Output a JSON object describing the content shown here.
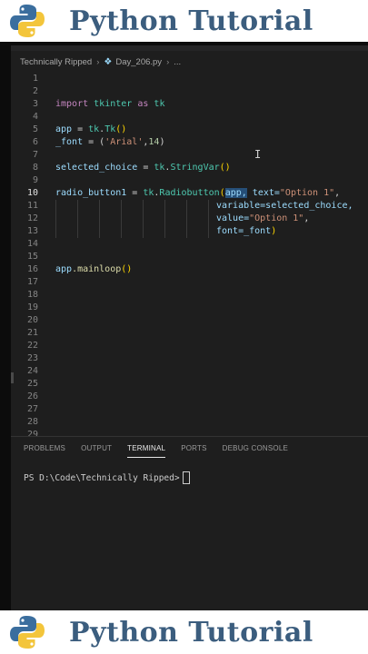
{
  "banner": {
    "title": "Python Tutorial"
  },
  "breadcrumb": {
    "folder": "Technically Ripped",
    "file": "Day_206.py",
    "ellipsis": "..."
  },
  "editor": {
    "active_line": "10",
    "lines": [
      {
        "n": "1"
      },
      {
        "n": "2"
      },
      {
        "n": "3"
      },
      {
        "n": "4"
      },
      {
        "n": "5"
      },
      {
        "n": "6"
      },
      {
        "n": "7"
      },
      {
        "n": "8"
      },
      {
        "n": "9"
      },
      {
        "n": "10"
      },
      {
        "n": "11"
      },
      {
        "n": "12"
      },
      {
        "n": "13"
      },
      {
        "n": "14"
      },
      {
        "n": "15"
      },
      {
        "n": "16"
      },
      {
        "n": "17"
      },
      {
        "n": "18"
      },
      {
        "n": "19"
      },
      {
        "n": "20"
      },
      {
        "n": "21"
      },
      {
        "n": "22"
      },
      {
        "n": "23"
      },
      {
        "n": "24"
      },
      {
        "n": "25"
      },
      {
        "n": "26"
      },
      {
        "n": "27"
      },
      {
        "n": "28"
      },
      {
        "n": "29"
      }
    ],
    "code": {
      "l3_import": "import",
      "l3_mod": "tkinter",
      "l3_as": "as",
      "l3_alias": "tk",
      "l5_var": "app",
      "l5_rest": " = ",
      "l5_mod": "tk",
      "l5_cls": "Tk",
      "l5_paren": "()",
      "l6_var": "_font",
      "l6_eq": " = (",
      "l6_str": "'Arial'",
      "l6_comma": ",",
      "l6_num": "14",
      "l6_close": ")",
      "l8_var": "selected_choice",
      "l8_eq": " = ",
      "l8_mod": "tk",
      "l8_cls": "StringVar",
      "l8_paren": "()",
      "l10_var": "radio_button1",
      "l10_eq": " = ",
      "l10_mod": "tk",
      "l10_cls": "Radiobutton",
      "l10_open": "(",
      "l10_app": "app,",
      "l10_text": " text=",
      "l10_str": "\"Option 1\"",
      "l10_comma": ",",
      "l11": "variable=selected_choice,",
      "l12_key": "value=",
      "l12_str": "\"Option 1\"",
      "l12_comma": ",",
      "l13_key": "font=_font",
      "l13_close": ")",
      "l16_var": "app",
      "l16_fn": ".mainloop",
      "l16_paren": "()"
    }
  },
  "panel": {
    "tabs": [
      "PROBLEMS",
      "OUTPUT",
      "TERMINAL",
      "PORTS",
      "DEBUG CONSOLE"
    ],
    "active_tab": "TERMINAL",
    "prompt": "PS D:\\Code\\Technically Ripped>"
  }
}
